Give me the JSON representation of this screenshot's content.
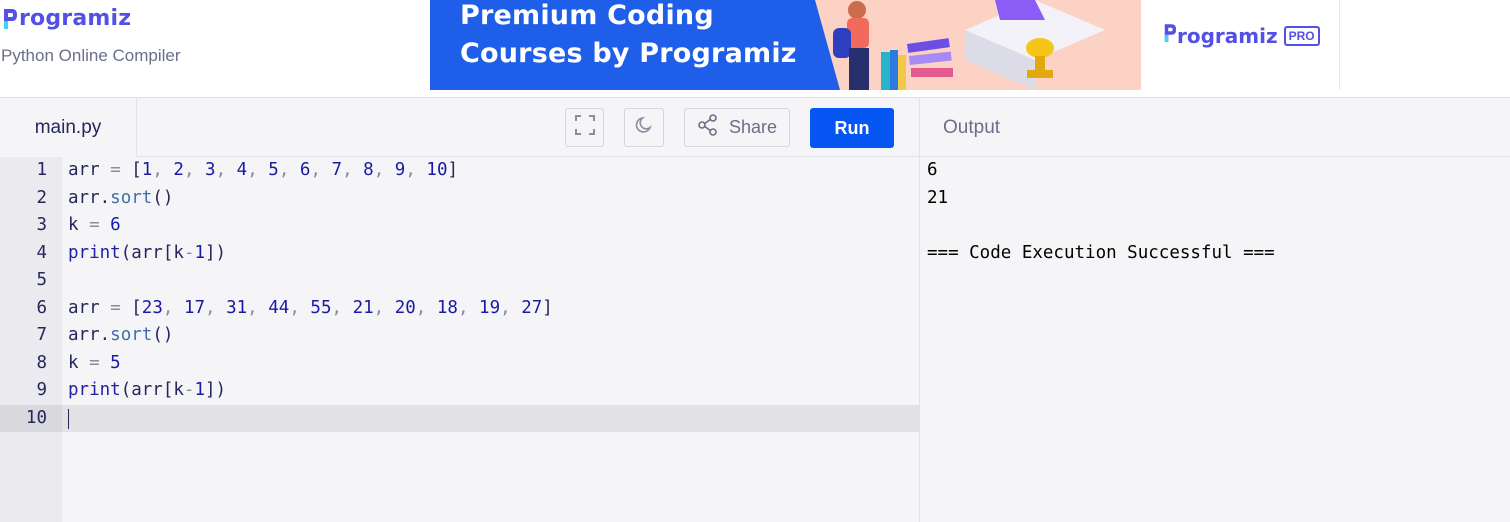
{
  "header": {
    "logo_text": "rogramiz",
    "subtitle": "Python Online Compiler"
  },
  "banner": {
    "line1": "Premium Coding",
    "line2": "Courses by Programiz",
    "pro_logo_text": "rogramiz",
    "pro_badge": "PRO"
  },
  "toolbar": {
    "file_tab": "main.py",
    "share_label": "Share",
    "run_label": "Run",
    "output_label": "Output",
    "icons": [
      "fullscreen-icon",
      "moon-icon",
      "share-icon"
    ]
  },
  "editor": {
    "active_line": 10,
    "lines": [
      {
        "num": "1",
        "tokens": [
          [
            "arr ",
            ""
          ],
          [
            "=",
            "op"
          ],
          [
            " [",
            ""
          ],
          [
            "1",
            "num"
          ],
          [
            ", ",
            "op"
          ],
          [
            "2",
            "num"
          ],
          [
            ", ",
            "op"
          ],
          [
            "3",
            "num"
          ],
          [
            ", ",
            "op"
          ],
          [
            "4",
            "num"
          ],
          [
            ", ",
            "op"
          ],
          [
            "5",
            "num"
          ],
          [
            ", ",
            "op"
          ],
          [
            "6",
            "num"
          ],
          [
            ", ",
            "op"
          ],
          [
            "7",
            "num"
          ],
          [
            ", ",
            "op"
          ],
          [
            "8",
            "num"
          ],
          [
            ", ",
            "op"
          ],
          [
            "9",
            "num"
          ],
          [
            ", ",
            "op"
          ],
          [
            "10",
            "num"
          ],
          [
            "]",
            ""
          ]
        ]
      },
      {
        "num": "2",
        "tokens": [
          [
            "arr.",
            ""
          ],
          [
            "sort",
            "meth"
          ],
          [
            "()",
            ""
          ]
        ]
      },
      {
        "num": "3",
        "tokens": [
          [
            "k ",
            ""
          ],
          [
            "=",
            "op"
          ],
          [
            " ",
            ""
          ],
          [
            "6",
            "num"
          ]
        ]
      },
      {
        "num": "4",
        "tokens": [
          [
            "print",
            "fn"
          ],
          [
            "(arr[k",
            ""
          ],
          [
            "-",
            "op"
          ],
          [
            "1",
            "num"
          ],
          [
            "])",
            ""
          ]
        ]
      },
      {
        "num": "5",
        "tokens": []
      },
      {
        "num": "6",
        "tokens": [
          [
            "arr ",
            ""
          ],
          [
            "=",
            "op"
          ],
          [
            " [",
            ""
          ],
          [
            "23",
            "num"
          ],
          [
            ", ",
            "op"
          ],
          [
            "17",
            "num"
          ],
          [
            ", ",
            "op"
          ],
          [
            "31",
            "num"
          ],
          [
            ", ",
            "op"
          ],
          [
            "44",
            "num"
          ],
          [
            ", ",
            "op"
          ],
          [
            "55",
            "num"
          ],
          [
            ", ",
            "op"
          ],
          [
            "21",
            "num"
          ],
          [
            ", ",
            "op"
          ],
          [
            "20",
            "num"
          ],
          [
            ", ",
            "op"
          ],
          [
            "18",
            "num"
          ],
          [
            ", ",
            "op"
          ],
          [
            "19",
            "num"
          ],
          [
            ", ",
            "op"
          ],
          [
            "27",
            "num"
          ],
          [
            "]",
            ""
          ]
        ]
      },
      {
        "num": "7",
        "tokens": [
          [
            "arr.",
            ""
          ],
          [
            "sort",
            "meth"
          ],
          [
            "()",
            ""
          ]
        ]
      },
      {
        "num": "8",
        "tokens": [
          [
            "k ",
            ""
          ],
          [
            "=",
            "op"
          ],
          [
            " ",
            ""
          ],
          [
            "5",
            "num"
          ]
        ]
      },
      {
        "num": "9",
        "tokens": [
          [
            "print",
            "fn"
          ],
          [
            "(arr[k",
            ""
          ],
          [
            "-",
            "op"
          ],
          [
            "1",
            "num"
          ],
          [
            "])",
            ""
          ]
        ]
      },
      {
        "num": "10",
        "tokens": []
      }
    ]
  },
  "output": {
    "lines": [
      "6",
      "21",
      "",
      "=== Code Execution Successful ==="
    ]
  },
  "colors": {
    "brand": "#5250e6",
    "run_button": "#0556f3",
    "banner_bg": "#1f5ee8"
  }
}
